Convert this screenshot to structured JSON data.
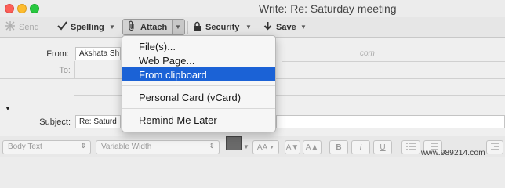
{
  "window": {
    "title": "Write: Re: Saturday meeting"
  },
  "toolbar": {
    "send_label": "Send",
    "spelling_label": "Spelling",
    "attach_label": "Attach",
    "security_label": "Security",
    "save_label": "Save",
    "icons": {
      "send": "send-icon",
      "spelling": "checkmark-icon",
      "attach": "paperclip-icon",
      "security": "lock-icon",
      "save": "download-arrow-icon"
    }
  },
  "attach_menu": {
    "items": [
      "File(s)...",
      "Web Page...",
      "From clipboard"
    ],
    "items2": [
      "Personal Card (vCard)"
    ],
    "items3": [
      "Remind Me Later"
    ],
    "selected": "From clipboard"
  },
  "fields": {
    "from_label": "From:",
    "from_value": "Akshata Sh",
    "from_suffix": "com",
    "to_label": "To:",
    "subject_label": "Subject:",
    "subject_value": "Re: Saturd"
  },
  "format_bar": {
    "style_value": "Body Text",
    "font_value": "Variable Width",
    "size_label": "AA",
    "size_dec": "A▼",
    "size_inc": "A▲",
    "bold": "B",
    "italic": "I",
    "underline": "U"
  },
  "watermark": "www.989214.com",
  "colors": {
    "menu_highlight": "#1b62d6",
    "close": "#fc5f57",
    "minimize": "#fdbc2e",
    "zoom": "#28c840"
  }
}
